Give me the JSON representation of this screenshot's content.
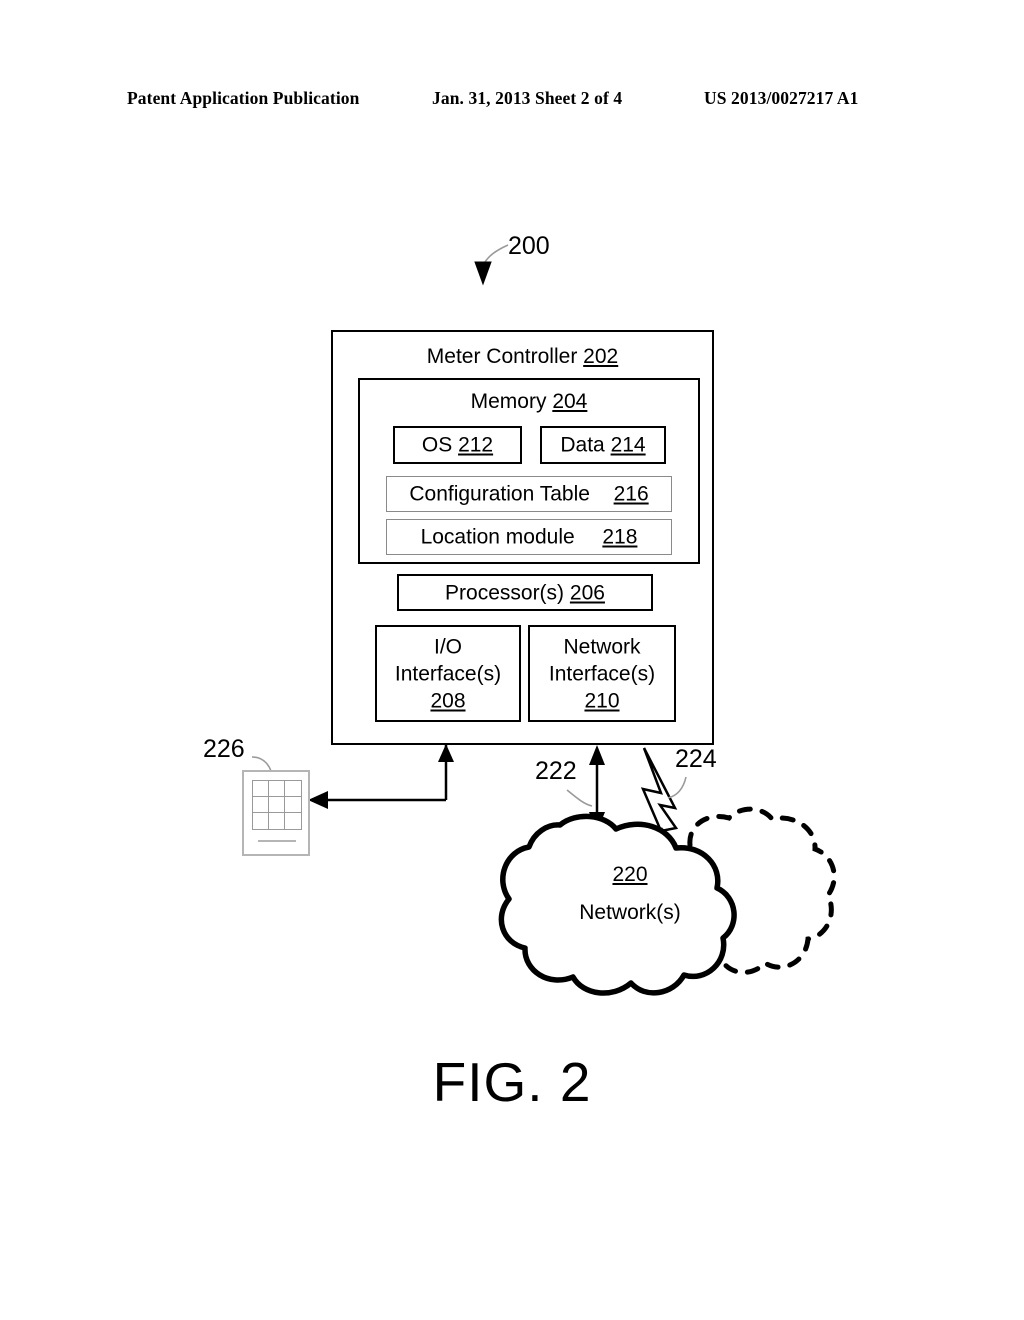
{
  "header": {
    "left": "Patent Application Publication",
    "middle": "Jan. 31, 2013  Sheet 2 of 4",
    "right": "US 2013/0027217 A1"
  },
  "figure": {
    "caption": "FIG. 2",
    "system_ref": "200"
  },
  "diagram": {
    "meter_controller": {
      "label": "Meter Controller",
      "ref": "202"
    },
    "memory": {
      "label": "Memory",
      "ref": "204"
    },
    "os": {
      "label": "OS",
      "ref": "212"
    },
    "data_store": {
      "label": "Data",
      "ref": "214"
    },
    "configuration_table": {
      "label": "Configuration Table",
      "ref": "216"
    },
    "location_module": {
      "label": "Location module",
      "ref": "218"
    },
    "processor": {
      "label": "Processor(s)",
      "ref": "206"
    },
    "io_interface": {
      "line1": "I/O",
      "line2": "Interface(s)",
      "ref": "208"
    },
    "network_interface": {
      "line1": "Network",
      "line2": "Interface(s)",
      "ref": "210"
    },
    "network_cloud": {
      "ref": "220",
      "label": "Network(s)"
    },
    "link_wired": {
      "ref": "222"
    },
    "link_wireless": {
      "ref": "224"
    },
    "meter_device": {
      "ref": "226"
    }
  }
}
